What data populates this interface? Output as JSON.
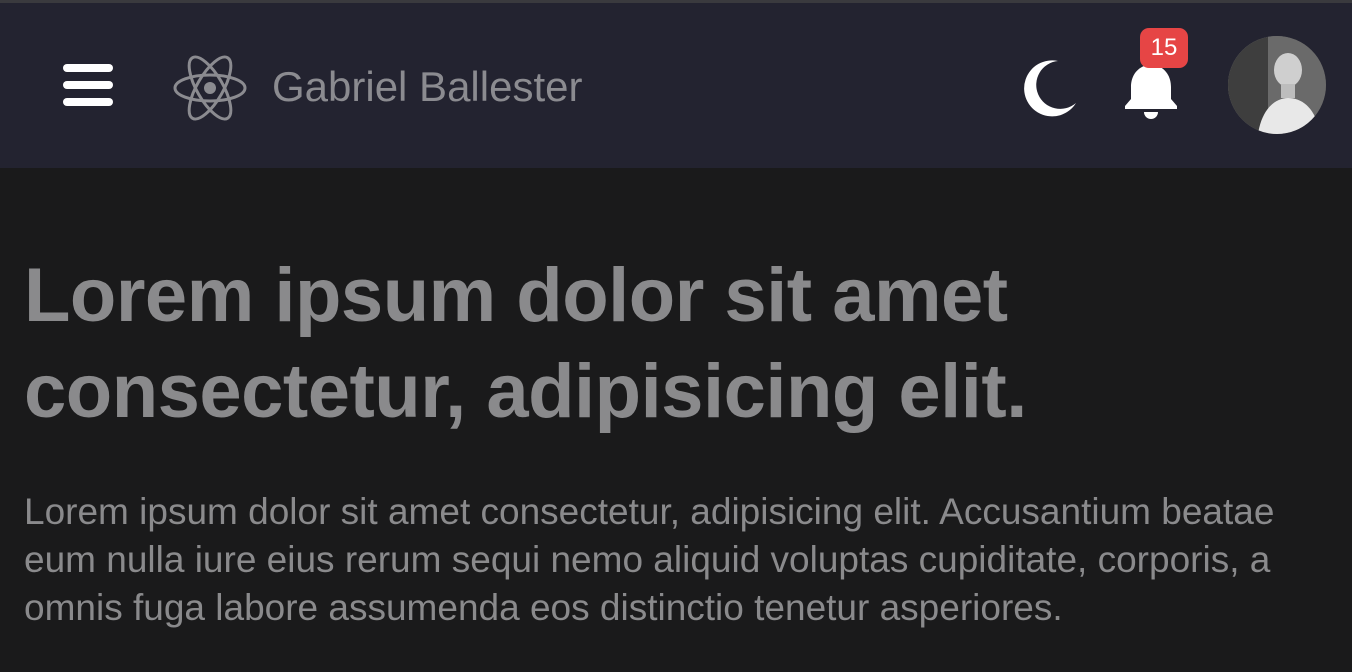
{
  "header": {
    "brand": "Gabriel Ballester",
    "notification_count": "15",
    "icons": {
      "menu": "hamburger-menu-icon",
      "logo": "react-atom-icon",
      "theme": "moon-icon",
      "notifications": "bell-icon",
      "avatar": "user-avatar"
    },
    "colors": {
      "background": "#232330",
      "badge": "#e64545",
      "icon": "#ffffff",
      "brand_text": "#8b8b90"
    }
  },
  "main": {
    "title": "Lorem ipsum dolor sit amet consectetur, adipisicing elit.",
    "paragraph": "Lorem ipsum dolor sit amet consectetur, adipisicing elit. Accusantium beatae eum nulla iure eius rerum sequi nemo aliquid voluptas cupiditate, corporis, a omnis fuga labore assumenda eos distinctio tenetur asperiores.",
    "colors": {
      "background": "#1a1a1b",
      "text": "#8a8a8c"
    }
  }
}
